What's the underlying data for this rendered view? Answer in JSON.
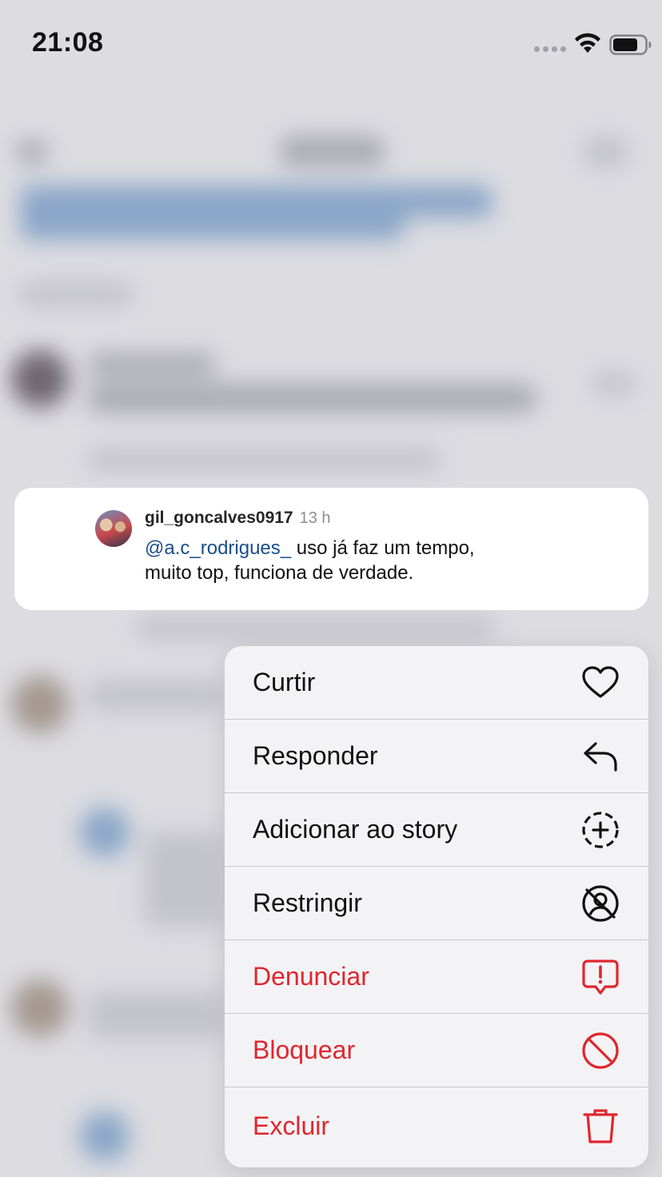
{
  "status_bar": {
    "time": "21:08"
  },
  "comment": {
    "username": "gil_goncalves0917",
    "time_ago": "13 h",
    "mention": "@a.c_rodrigues_",
    "text_line1": " uso já faz um tempo,",
    "text_line2": "muito top,  funciona de verdade."
  },
  "menu": {
    "items": [
      {
        "label": "Curtir",
        "icon": "heart-icon",
        "danger": false
      },
      {
        "label": "Responder",
        "icon": "reply-icon",
        "danger": false
      },
      {
        "label": "Adicionar ao story",
        "icon": "add-story-icon",
        "danger": false
      },
      {
        "label": "Restringir",
        "icon": "restrict-icon",
        "danger": false
      },
      {
        "label": "Denunciar",
        "icon": "report-icon",
        "danger": true
      },
      {
        "label": "Bloquear",
        "icon": "block-icon",
        "danger": true
      },
      {
        "label": "Excluir",
        "icon": "trash-icon",
        "danger": true
      }
    ]
  },
  "colors": {
    "danger": "#e0262e",
    "mention": "#1a4e8a",
    "menu_bg": "#f3f3f5"
  }
}
